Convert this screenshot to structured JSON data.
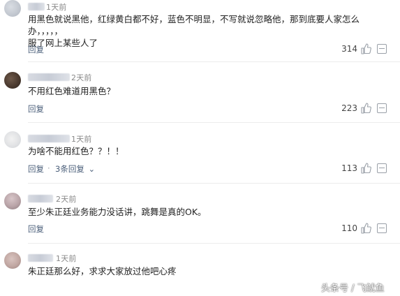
{
  "comments": [
    {
      "time": "1天前",
      "text_line1": "用黑色就说黑他，红绿黄白都不好，蓝色不明显，不写就说忽略他，那到底要人家怎么办，，，，，",
      "text_line2": "服了网上某些人了",
      "reply_label": "回复",
      "likes": "314"
    },
    {
      "time": "2天前",
      "text_line1": "不用红色难道用黑色？",
      "reply_label": "回复",
      "likes": "223"
    },
    {
      "time": "1天前",
      "text_line1": "为啥不能用红色？？！！",
      "reply_label": "回复",
      "reply_sep": "·",
      "more_replies": "3条回复",
      "more_replies_arrow": "⌄",
      "likes": "113"
    },
    {
      "time": "2天前",
      "text_line1": "至少朱正廷业务能力没话讲，跳舞是真的OK。",
      "reply_label": "回复",
      "likes": "110"
    },
    {
      "time": "1天前",
      "text_line1": "朱正廷那么好，求求大家放过他吧心疼"
    }
  ],
  "watermark": "头条号 / 飞鱿鱼",
  "colors": {
    "reply_link": "#4b5f7a",
    "meta_gray": "#888888",
    "divider": "#ececec"
  },
  "icons": {
    "like": "thumbs-up-icon",
    "more": "more-options-icon"
  }
}
